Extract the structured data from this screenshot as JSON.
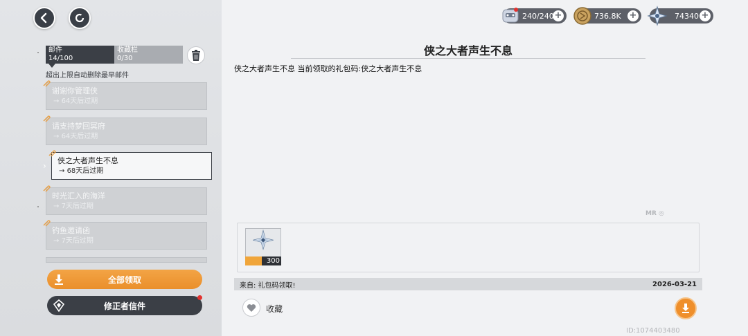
{
  "resources": [
    {
      "name": "stamina",
      "value": "240/240",
      "icon": "stamina-icon"
    },
    {
      "name": "coins",
      "value": "736.8K",
      "icon": "coin-icon"
    },
    {
      "name": "crystals",
      "value": "74340",
      "icon": "crystal-icon"
    }
  ],
  "tabs": {
    "mail_label": "邮件",
    "mail_count": "14/100",
    "favorites_label": "收藏栏",
    "favorites_count": "0/30"
  },
  "auto_delete_note": "超出上限自动删除最早邮件",
  "mail_items": [
    {
      "title": "谢谢你管理侠",
      "expire": "64天后过期"
    },
    {
      "title": "请支持梦回冥府",
      "expire": "64天后过期"
    },
    {
      "title": "侠之大者声生不息",
      "expire": "68天后过期"
    },
    {
      "title": "时光汇入的海洋",
      "expire": "7天后过期"
    },
    {
      "title": "钓鱼邀请函",
      "expire": "7天后过期"
    }
  ],
  "buttons": {
    "claim_all": "全部领取",
    "corrector_letter": "修正者信件",
    "favorite": "收藏"
  },
  "mail_detail": {
    "title": "侠之大者声生不息",
    "body": "侠之大者声生不息  当前领取的礼包码:侠之大者声生不息",
    "attachment_count": "300",
    "from": "来自:  礼包码领取!",
    "date": "2026-03-21"
  },
  "player_id": "ID:1074403480",
  "colors": {
    "accent": "#ea8f2b",
    "dark": "#3b3f46"
  }
}
